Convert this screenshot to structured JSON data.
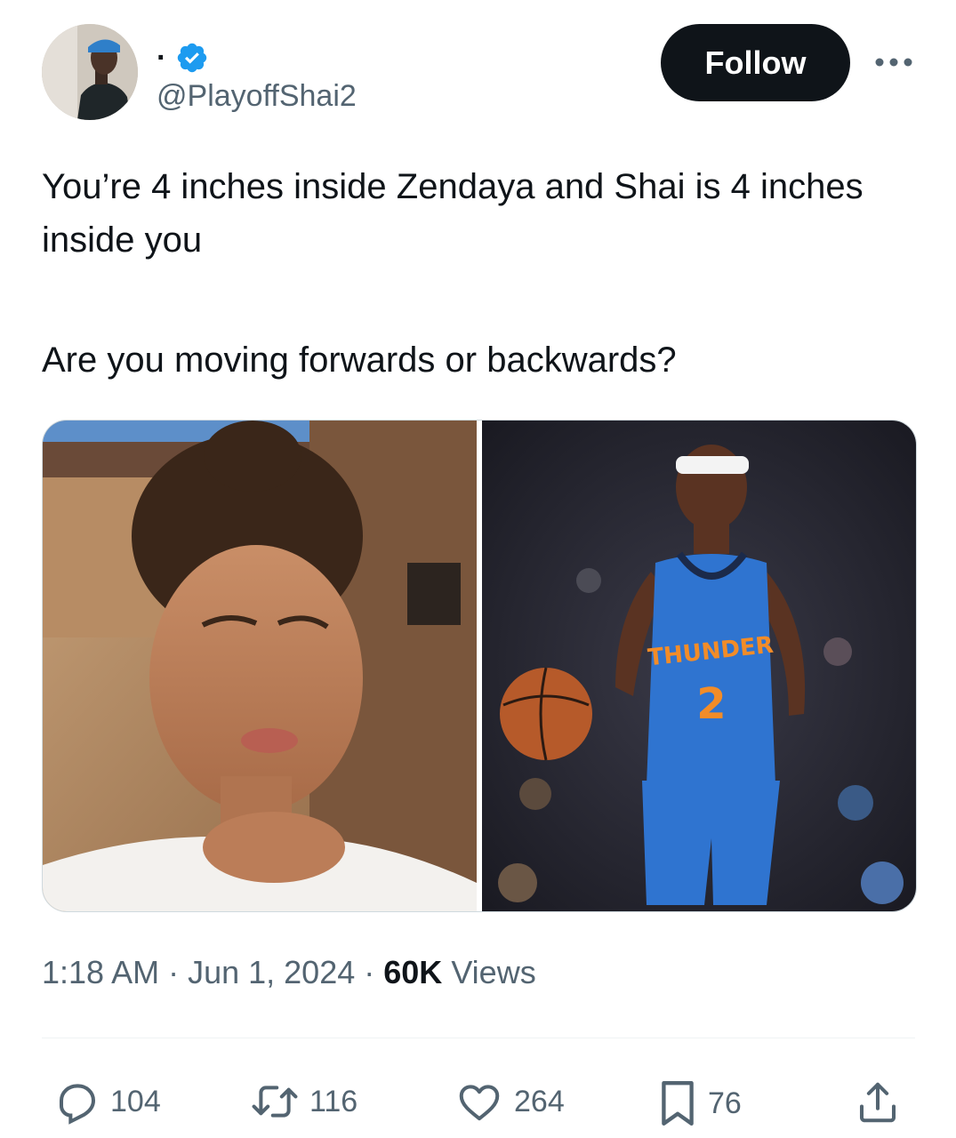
{
  "account": {
    "display_name": "·",
    "handle": "@PlayoffShai2",
    "verified": true
  },
  "header": {
    "follow_label": "Follow",
    "more_label": "···"
  },
  "tweet": {
    "line1": "You’re 4 inches inside Zendaya and Shai is 4 inches inside you",
    "line2": "Are you moving forwards or backwards?"
  },
  "media": {
    "images": [
      {
        "label": "Selfie photo"
      },
      {
        "label": "Basketball player photo"
      }
    ],
    "jersey_text": "THUNDER",
    "jersey_number": "2"
  },
  "meta": {
    "time": "1:18 AM",
    "date": "Jun 1, 2024",
    "views_count": "60K",
    "views_label": "Views",
    "separator": " · "
  },
  "actions": {
    "replies": "104",
    "reposts": "116",
    "likes": "264",
    "bookmarks": "76"
  },
  "colors": {
    "text": "#0f1419",
    "secondary": "#536471",
    "verified": "#1d9bf0",
    "jersey": "#2f74d0"
  }
}
